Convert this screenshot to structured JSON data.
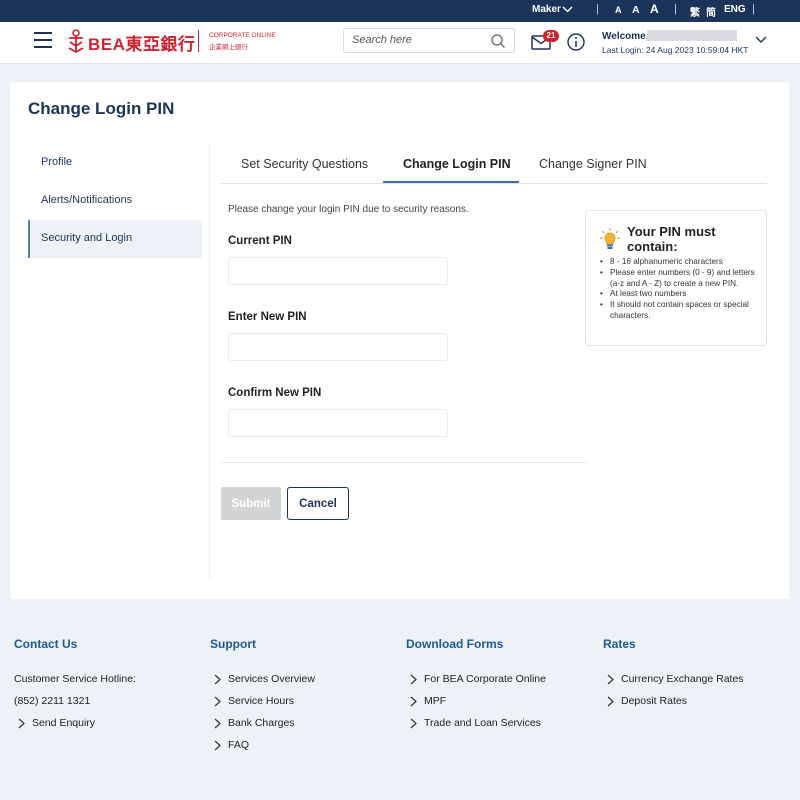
{
  "topbar": {
    "role": "Maker",
    "font_small": "A",
    "font_medium": "A",
    "font_large": "A",
    "lang_trad": "繁",
    "lang_simp": "简",
    "lang_eng": "ENG"
  },
  "header": {
    "logo_text": "BEA東亞銀行",
    "logo_sub_en": "CORPORATE ONLINE",
    "logo_sub_zh": "企業網上銀行",
    "search_placeholder": "Search here",
    "mail_count": "21",
    "welcome": "Welcome,",
    "last_login": "Last Login: 24 Aug 2023 10:59:04 HKT"
  },
  "page": {
    "title": "Change Login PIN"
  },
  "sidebar": {
    "items": [
      {
        "label": "Profile"
      },
      {
        "label": "Alerts/Notifications"
      },
      {
        "label": "Security and Login"
      }
    ]
  },
  "tabs": [
    {
      "label": "Set Security Questions"
    },
    {
      "label": "Change Login PIN"
    },
    {
      "label": "Change Signer PIN"
    }
  ],
  "form": {
    "message": "Please change your login PIN due to security reasons.",
    "current_pin_label": "Current PIN",
    "new_pin_label": "Enter New PIN",
    "confirm_pin_label": "Confirm New PIN",
    "submit_label": "Submit",
    "cancel_label": "Cancel"
  },
  "pin_rules": {
    "title": "Your PIN must contain:",
    "rules": [
      "8 - 16 alphanumeric characters",
      "Please enter numbers (0 - 9) and letters (a-z and A - Z) to create a new PIN.",
      "At least two numbers",
      "It should not contain spaces or special characters."
    ]
  },
  "footer": {
    "contact": {
      "title": "Contact Us",
      "hotline_label": "Customer Service Hotline:",
      "hotline_number": "(852) 2211 1321",
      "send_enquiry": "Send Enquiry"
    },
    "support": {
      "title": "Support",
      "links": [
        "Services Overview",
        "Service Hours",
        "Bank Charges",
        "FAQ"
      ]
    },
    "forms": {
      "title": "Download Forms",
      "links": [
        "For BEA Corporate Online",
        "MPF",
        "Trade and Loan Services"
      ]
    },
    "rates": {
      "title": "Rates",
      "links": [
        "Currency Exchange Rates",
        "Deposit Rates"
      ]
    }
  },
  "colors": {
    "navy": "#1c3459",
    "brand_red": "#d0222e",
    "footer_title": "#1c5a93",
    "tab_underline": "#3a6ea8"
  }
}
